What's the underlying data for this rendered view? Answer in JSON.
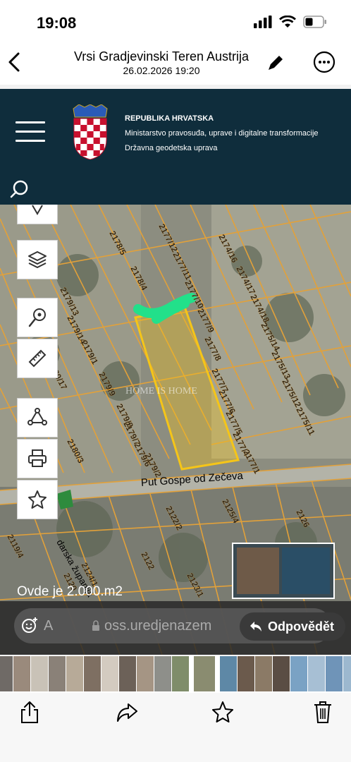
{
  "status_bar": {
    "time": "19:08"
  },
  "header": {
    "title": "Vrsi Gradjevinski Teren Austrija",
    "subtitle": "26.02.2026 19:20"
  },
  "gov_site": {
    "line1": "REPUBLIKA HRVATSKA",
    "line2": "Ministarstvo pravosuđa, uprave i digitalne transformacije",
    "line3": "Državna geodetska uprava"
  },
  "map": {
    "street": "Put Gospe od Zečeva",
    "county": "darska županija",
    "watermark": "HOME IS HOME",
    "parcels": [
      "2178/5",
      "2178/4",
      "2177/12",
      "2177/11",
      "2177/10",
      "2177/9",
      "2177/8",
      "2177/7",
      "2177/6",
      "2177/5",
      "2177/4",
      "2177/1",
      "2174/16",
      "2174/17",
      "2174/18",
      "2175/14",
      "2175/13",
      "2175/12",
      "2175/11",
      "2179/13",
      "2179/14",
      "2179/1",
      "2180/17",
      "2179/9",
      "2179/8",
      "2179/7",
      "2179/6",
      "2179/2",
      "2180/3",
      "2122/2",
      "2125/4",
      "2124/1",
      "2123/1",
      "2122",
      "2120",
      "2119/4",
      "2126"
    ]
  },
  "caption": "Ovde je 2.000.m2",
  "reply": {
    "placeholder": "A",
    "url": "oss.uredjenazem",
    "reply_label": "Odpovědět"
  },
  "colors": {
    "gov_header": "#0f2d3c",
    "parcel_highlight": "#f5c518",
    "parcel_lines": "#e2a13a"
  },
  "toolbar": {
    "icons": [
      "share-icon",
      "forward-icon",
      "star-icon",
      "trash-icon"
    ]
  }
}
